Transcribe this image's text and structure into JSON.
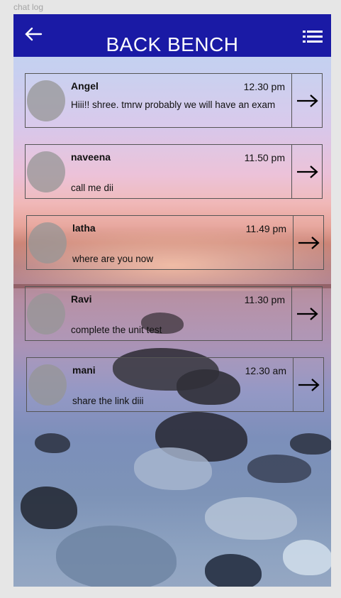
{
  "frame_label": "chat log",
  "header": {
    "title": "BACK BENCH",
    "back_icon": "arrow-left-icon",
    "menu_icon": "list-menu-icon",
    "background_color": "#1a1aa5"
  },
  "chats": [
    {
      "name": "Angel",
      "time": "12.30 pm",
      "message": "Hiii!! shree. tmrw probably we will have an exam"
    },
    {
      "name": "naveena",
      "time": "11.50 pm",
      "message": "call me dii"
    },
    {
      "name": "latha",
      "time": "11.49 pm",
      "message": "where are you now"
    },
    {
      "name": "Ravi",
      "time": "11.30 pm",
      "message": "complete the unit test"
    },
    {
      "name": "mani",
      "time": "12.30 am",
      "message": "share the link diii"
    }
  ],
  "item_action_icon": "arrow-right-icon"
}
